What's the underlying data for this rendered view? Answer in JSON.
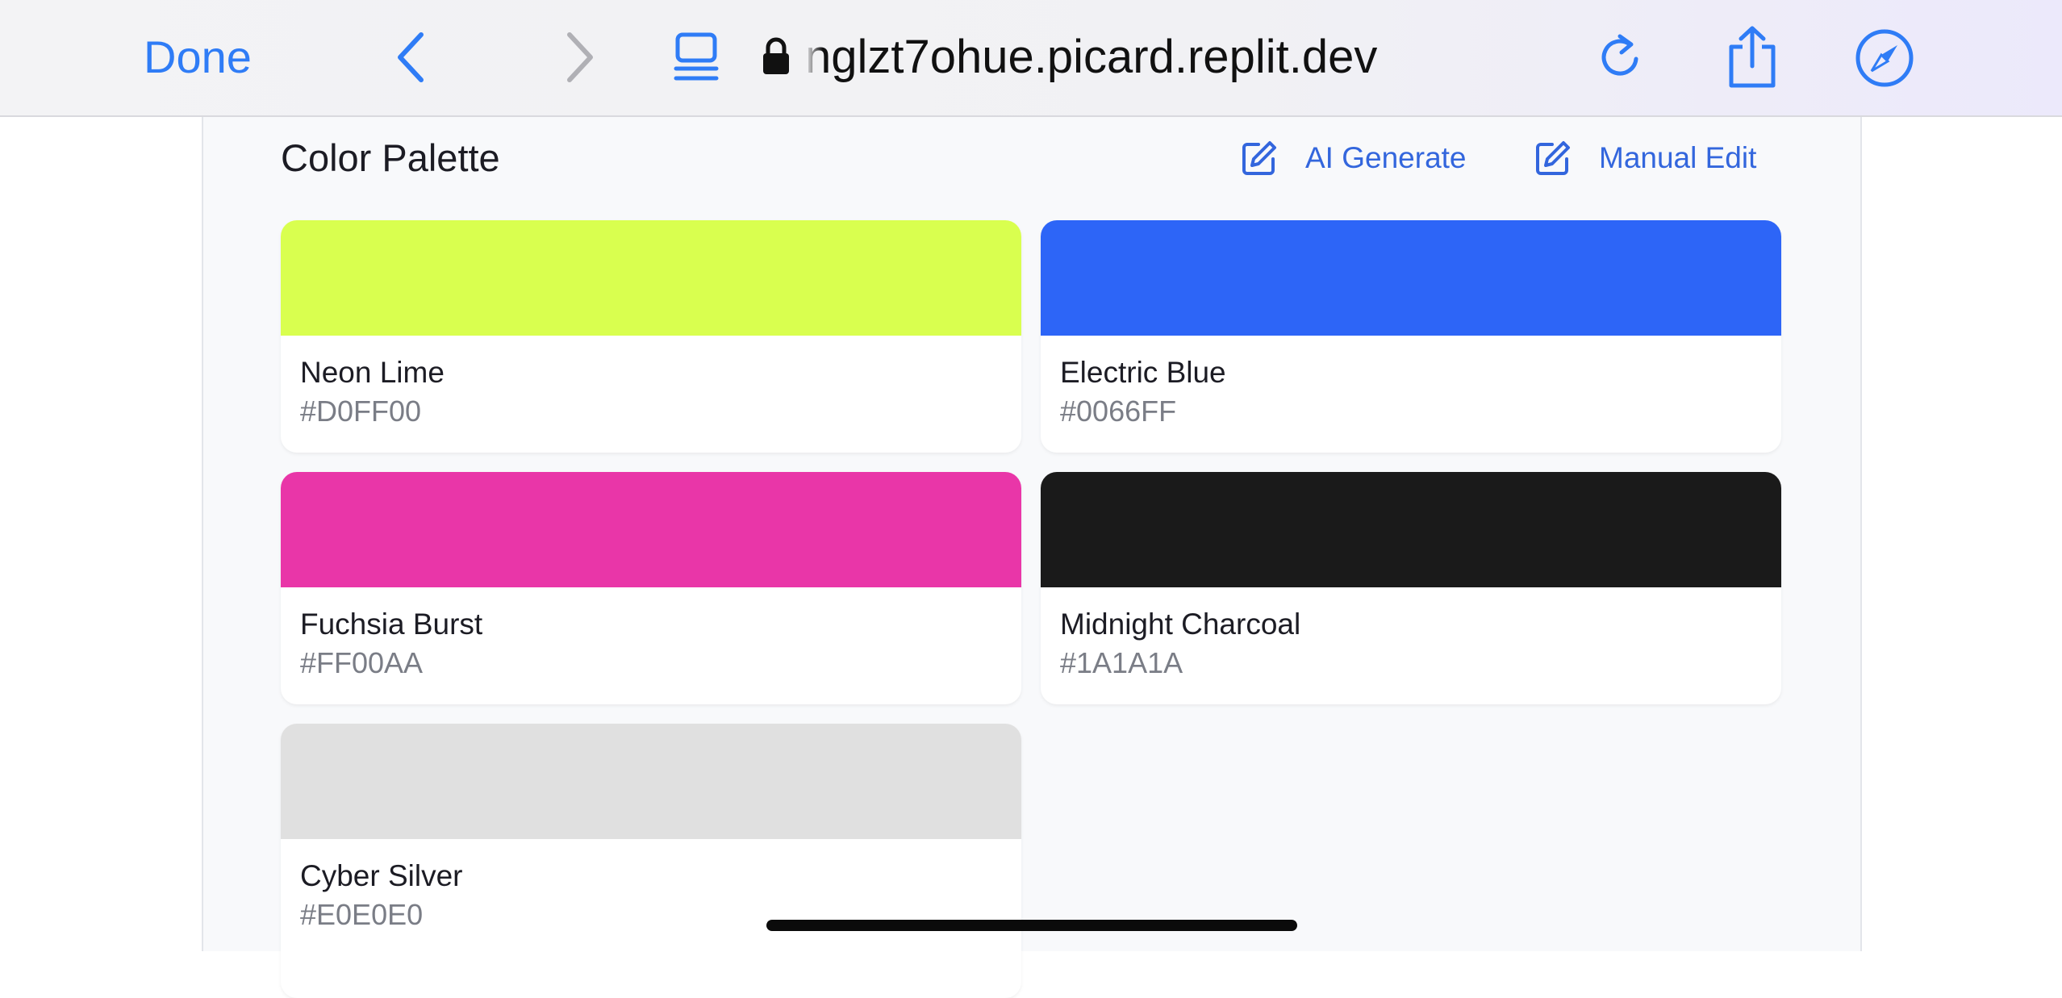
{
  "browser": {
    "done_label": "Done",
    "url": "nglzt7ohue.picard.replit.dev",
    "icons": {
      "back": "chevron-left-icon",
      "forward": "chevron-right-icon",
      "tabs": "tabs-icon",
      "lock": "lock-icon",
      "reload": "reload-icon",
      "share": "share-icon",
      "safari": "compass-icon"
    },
    "accent_color": "#2f7cf6"
  },
  "palette": {
    "title": "Color Palette",
    "actions": {
      "ai_generate_label": "AI Generate",
      "manual_edit_label": "Manual Edit"
    },
    "swatches": [
      {
        "name": "Neon Lime",
        "hex": "#D0FF00",
        "display_color": "#d9ff4f"
      },
      {
        "name": "Electric Blue",
        "hex": "#0066FF",
        "display_color": "#2d65f7"
      },
      {
        "name": "Fuchsia Burst",
        "hex": "#FF00AA",
        "display_color": "#e936a8"
      },
      {
        "name": "Midnight Charcoal",
        "hex": "#1A1A1A",
        "display_color": "#1a1a1a"
      },
      {
        "name": "Cyber Silver",
        "hex": "#E0E0E0",
        "display_color": "#e0e0e0"
      }
    ]
  }
}
